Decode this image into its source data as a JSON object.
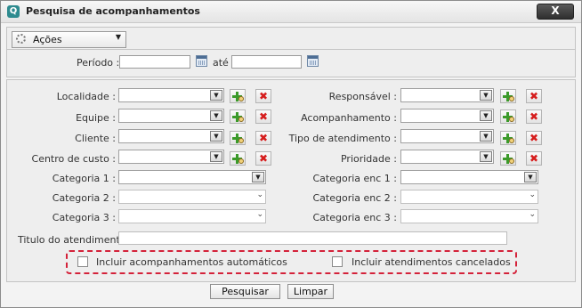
{
  "window": {
    "title": "Pesquisa de acompanhamentos",
    "close_label": "X"
  },
  "toolbar": {
    "actions_label": "Ações",
    "actions_icon": "gear-icon",
    "dropdown_arrow": "▼"
  },
  "period": {
    "label": "Período :",
    "required_mark": "*",
    "separator": "até",
    "from_value": "",
    "to_value": ""
  },
  "filters": {
    "localidade": "Localidade :",
    "equipe": "Equipe :",
    "cliente": "Cliente :",
    "centro_custo": "Centro de custo :",
    "categoria1": "Categoria 1 :",
    "categoria2": "Categoria 2 :",
    "categoria3": "Categoria 3 :",
    "responsavel": "Responsável :",
    "acompanhamento": "Acompanhamento :",
    "tipo_atendimento": "Tipo de atendimento :",
    "prioridade": "Prioridade :",
    "categoria_enc1": "Categoria enc 1 :",
    "categoria_enc2": "Categoria enc 2 :",
    "categoria_enc3": "Categoria enc 3 :"
  },
  "title_field": {
    "label": "Titulo do atendimento:",
    "value": ""
  },
  "options": {
    "auto_label": "Incluir acompanhamentos automáticos",
    "canceled_label": "Incluir atendimentos cancelados",
    "auto_checked": false,
    "canceled_checked": false
  },
  "buttons": {
    "search": "Pesquisar",
    "clear": "Limpar"
  },
  "colors": {
    "accent": "#2e8b8f",
    "highlight_border": "#d4223a",
    "delete_icon": "#d61d1d",
    "add_icon": "#3b9a2a"
  }
}
